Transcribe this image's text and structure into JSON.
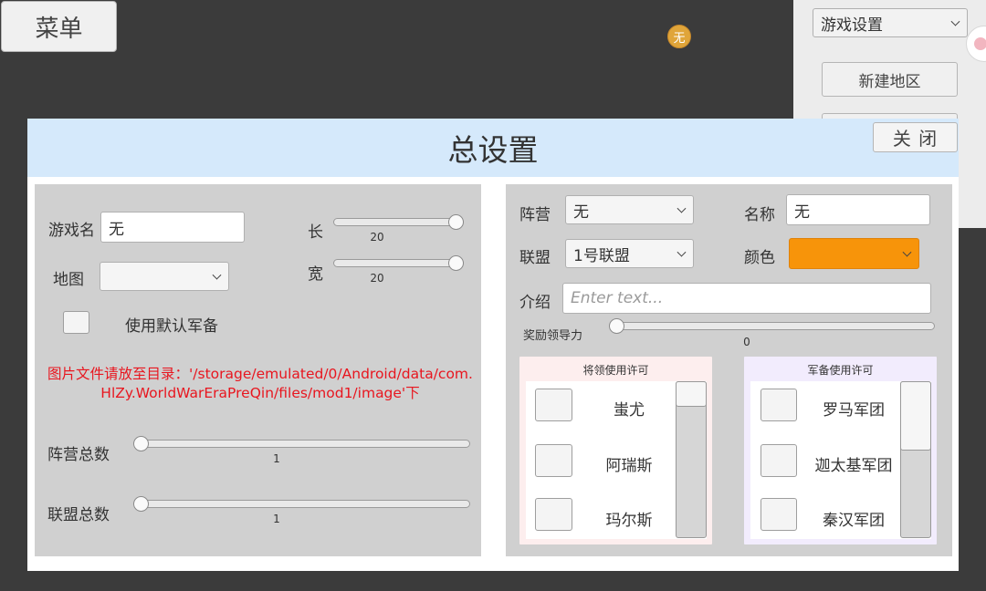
{
  "top_menu": {
    "label": "菜单"
  },
  "avatar": {
    "label": "无"
  },
  "right_panel": {
    "game_settings_select": "游戏设置",
    "new_region_button": "新建地区"
  },
  "dialog": {
    "title": "总设置",
    "close_label": "关 闭",
    "left": {
      "game_name_label": "游戏名",
      "game_name_value": "无",
      "map_label": "地图",
      "map_value": "",
      "length_label": "长",
      "length_value": "20",
      "width_label": "宽",
      "width_value": "20",
      "default_equipment_label": "使用默认军备",
      "image_notice": "图片文件请放至目录：'/storage/emulated/0/Android/data/com.HlZy.WorldWarEraPreQin/files/mod1/image'下",
      "faction_count_label": "阵营总数",
      "faction_count_value": "1",
      "alliance_count_label": "联盟总数",
      "alliance_count_value": "1"
    },
    "right": {
      "faction_label": "阵营",
      "faction_value": "无",
      "name_label": "名称",
      "name_value": "无",
      "alliance_label": "联盟",
      "alliance_value": "1号联盟",
      "color_label": "颜色",
      "color_value": "#f7940a",
      "intro_label": "介绍",
      "intro_placeholder": "Enter text...",
      "reward_label": "奖励领导力",
      "reward_value": "0",
      "general_permission": {
        "title": "将领使用许可",
        "items": [
          "蚩尤",
          "阿瑞斯",
          "玛尔斯"
        ]
      },
      "equipment_permission": {
        "title": "军备使用许可",
        "items": [
          "罗马军团",
          "迦太基军团",
          "秦汉军团"
        ]
      }
    }
  },
  "colors": {
    "background": "#3b3b3b",
    "dialog_header": "#d5e9fb",
    "panel_gray": "#d0d0d0",
    "notice_red": "#e8161f",
    "avatar_gold": "#e0a53a",
    "general_panel": "#fdeeee",
    "equipment_panel": "#f2ecfd"
  }
}
